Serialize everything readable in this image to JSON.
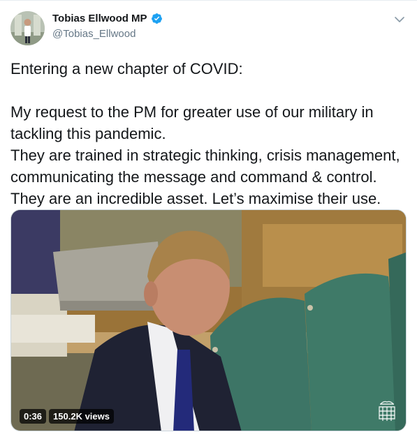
{
  "author": {
    "display_name": "Tobias Ellwood MP",
    "handle": "@Tobias_Ellwood",
    "verified": true
  },
  "tweet": {
    "lines": [
      "Entering a new chapter of COVID:",
      "",
      "My request to the PM for greater use of our military in tackling this pandemic.",
      "They are trained in strategic thinking, crisis management, communicating the message and command & control.",
      "They are an incredible asset. Let’s maximise their use."
    ]
  },
  "media": {
    "duration": "0:36",
    "views": "150.2K views"
  },
  "colors": {
    "text": "#14171a",
    "secondary": "#657786",
    "verified": "#1da1f2"
  },
  "icons": [
    "verified-badge-icon",
    "chevron-down-icon",
    "portcullis-logo-icon"
  ]
}
